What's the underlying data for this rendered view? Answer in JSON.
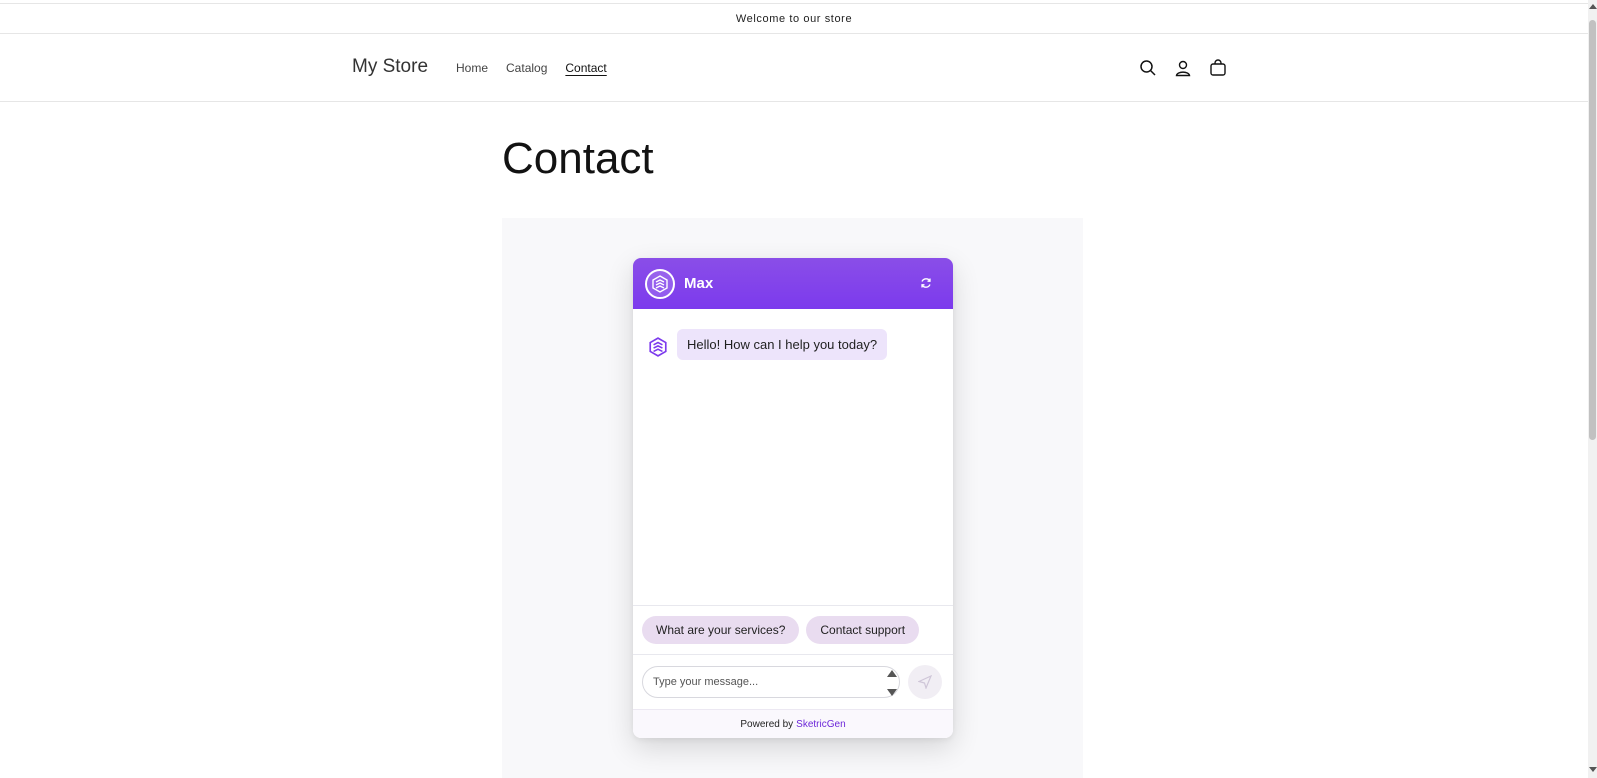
{
  "announcement": {
    "text": "Welcome to our store"
  },
  "header": {
    "logo": "My Store",
    "nav": [
      {
        "label": "Home",
        "active": false
      },
      {
        "label": "Catalog",
        "active": false
      },
      {
        "label": "Contact",
        "active": true
      }
    ],
    "icons": [
      "search-icon",
      "account-icon",
      "cart-icon"
    ]
  },
  "page": {
    "title": "Contact"
  },
  "chat": {
    "agent_name": "Max",
    "accent_color": "#7c3aed",
    "messages": [
      {
        "from": "bot",
        "text": "Hello! How can I help you today?"
      }
    ],
    "suggestions": [
      "What are your services?",
      "Contact support"
    ],
    "input": {
      "placeholder": "Type your message..."
    },
    "footer": {
      "prefix": "Powered by",
      "brand": "SketricGen"
    }
  }
}
